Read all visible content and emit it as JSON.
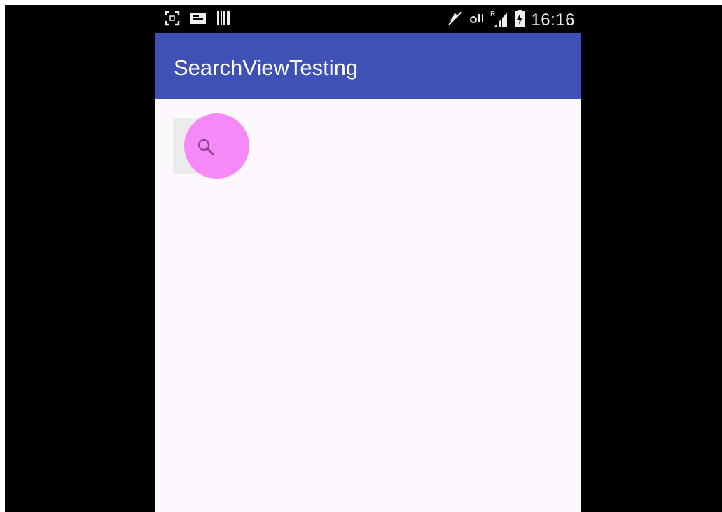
{
  "status_bar": {
    "time": "16:16",
    "left_icons": [
      "screenshot-icon",
      "gallery-notification-icon",
      "barcode-icon"
    ],
    "right_icons": [
      "mute-icon",
      "nfc-icon",
      "signal-roaming-icon",
      "battery-charging-icon"
    ]
  },
  "app_bar": {
    "title": "SearchViewTesting",
    "color": "#3f51b5"
  },
  "search_view": {
    "icon": "search-icon",
    "state": "collapsed"
  },
  "touch_indicator": {
    "color": "#f788f7"
  }
}
